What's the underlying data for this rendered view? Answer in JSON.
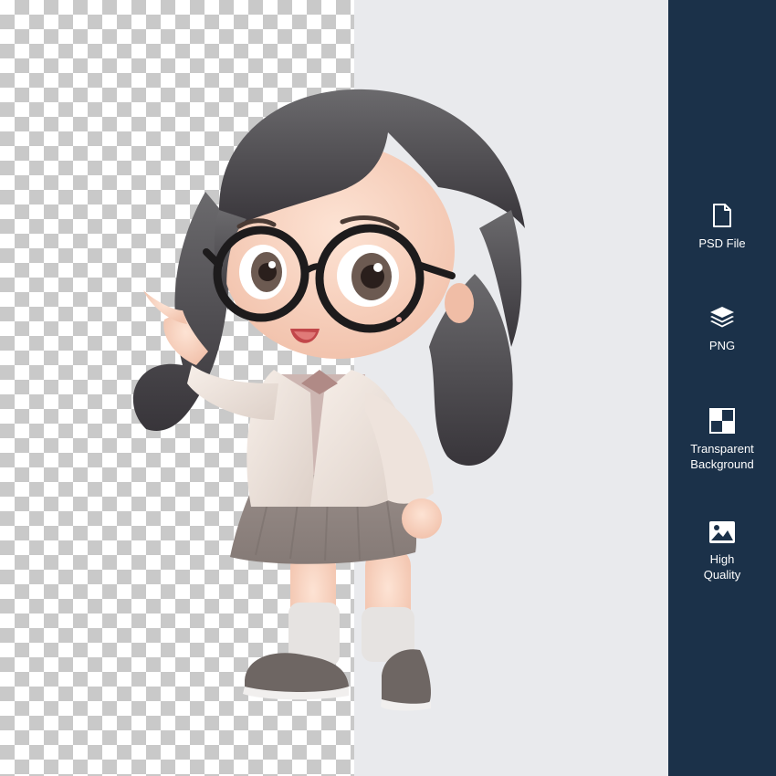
{
  "sidebar": {
    "background": "#1b3149",
    "features": [
      {
        "icon": "file-icon",
        "label": "PSD File"
      },
      {
        "icon": "layers-icon",
        "label": "PNG"
      },
      {
        "icon": "transparency-grid-icon",
        "label": "Transparent\nBackground"
      },
      {
        "icon": "image-icon",
        "label": "High\nQuality"
      }
    ]
  },
  "preview": {
    "checker_color": "#c9c9c9",
    "panel_color": "#e9eaed",
    "subject": "character-figure"
  }
}
